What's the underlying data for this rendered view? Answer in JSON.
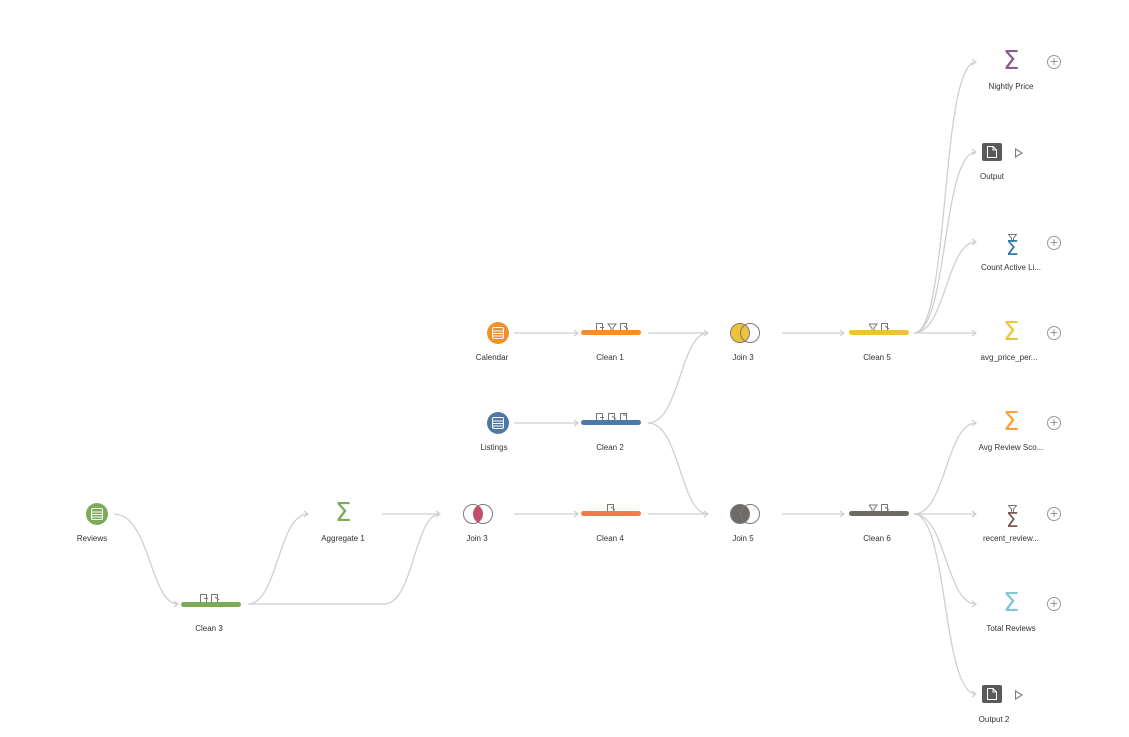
{
  "colors": {
    "calendar": "#f28e2b",
    "listings": "#4e79a7",
    "reviews": "#7aab56",
    "clean4": "#f07c4a",
    "clean5": "#f0c23a",
    "clean6": "#6e6a66",
    "connector": "#cfcfcf",
    "nightly": "#8b5a8e",
    "count": "#2e7bb0",
    "avg_price": "#f0c23a",
    "avg_review": "#f7a33a",
    "recent": "#7a5a52",
    "total": "#7fc8d4",
    "aggregate": "#7aab56"
  },
  "nodes": {
    "reviews": {
      "label": "Reviews",
      "icon": "table-icon"
    },
    "clean3": {
      "label": "Clean 3",
      "icon": "clean-bar"
    },
    "aggregate1": {
      "label": "Aggregate 1",
      "icon": "sigma-icon"
    },
    "join3": {
      "label": "Join 3",
      "icon": "join-inner-icon"
    },
    "calendar": {
      "label": "Calendar",
      "icon": "table-icon"
    },
    "listings": {
      "label": "Listings",
      "icon": "table-icon"
    },
    "clean1": {
      "label": "Clean 1",
      "icon": "clean-bar"
    },
    "clean2": {
      "label": "Clean 2",
      "icon": "clean-bar"
    },
    "clean4": {
      "label": "Clean 4",
      "icon": "clean-bar"
    },
    "join3_top": {
      "label": "Join 3",
      "icon": "join-left-icon"
    },
    "join5": {
      "label": "Join 5",
      "icon": "join-left-icon"
    },
    "clean5": {
      "label": "Clean 5",
      "icon": "clean-bar"
    },
    "clean6": {
      "label": "Clean 6",
      "icon": "clean-bar"
    },
    "nightly": {
      "label": "Nightly Price",
      "icon": "sigma-icon"
    },
    "output": {
      "label": "Output",
      "icon": "output-icon"
    },
    "count_active": {
      "label": "Count Active Li...",
      "icon": "sigma-icon"
    },
    "avg_price": {
      "label": "avg_price_per...",
      "icon": "sigma-icon"
    },
    "avg_review": {
      "label": "Avg Review Sco...",
      "icon": "sigma-icon"
    },
    "recent": {
      "label": "recent_review...",
      "icon": "sigma-icon"
    },
    "total": {
      "label": "Total Reviews",
      "icon": "sigma-icon"
    },
    "output2": {
      "label": "Output 2",
      "icon": "output-icon"
    }
  },
  "sigma_glyph": "Σ",
  "plus_glyph": "+"
}
